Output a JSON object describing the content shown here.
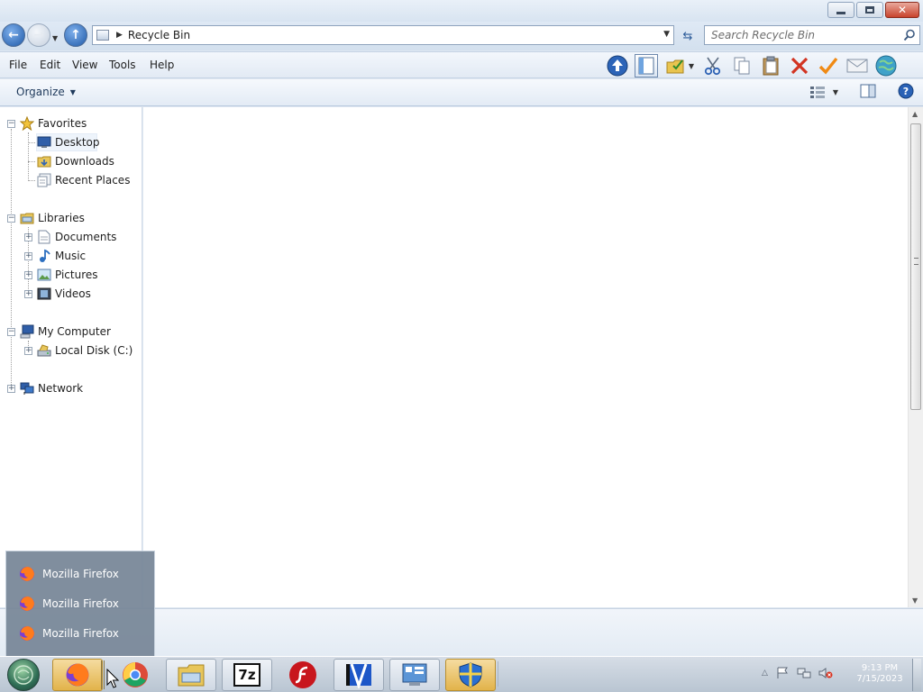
{
  "address": {
    "breadcrumb": "Recycle Bin",
    "search_placeholder": "Search Recycle Bin"
  },
  "menu": {
    "file": "File",
    "edit": "Edit",
    "view": "View",
    "tools": "Tools",
    "help": "Help"
  },
  "toolbar_icons": [
    "up-arrow-icon",
    "preview-pane-icon",
    "check-folder-icon",
    "cut-icon",
    "copy-icon",
    "paste-icon",
    "delete-icon",
    "check-icon",
    "mail-icon",
    "globe-icon"
  ],
  "command_bar": {
    "organize": "Organize"
  },
  "nav": {
    "favorites": "Favorites",
    "desktop": "Desktop",
    "downloads": "Downloads",
    "recent_places": "Recent Places",
    "libraries": "Libraries",
    "documents": "Documents",
    "music": "Music",
    "pictures": "Pictures",
    "videos": "Videos",
    "my_computer": "My Computer",
    "local_disk": "Local Disk (C:)",
    "network": "Network"
  },
  "jump_list": {
    "items": [
      "Mozilla Firefox",
      "Mozilla Firefox",
      "Mozilla Firefox"
    ]
  },
  "taskbar": {
    "apps": [
      "firefox",
      "chrome",
      "file-explorer",
      "7zip",
      "flash",
      "video-editor",
      "control-panel",
      "security-shield"
    ],
    "app_7z_label": "7z",
    "clock_time": "9:13 PM",
    "clock_date": "7/15/2023"
  },
  "colors": {
    "accent": "#2f63b5",
    "taskbar_active": "#e2b34a",
    "close_red": "#c8432c"
  }
}
